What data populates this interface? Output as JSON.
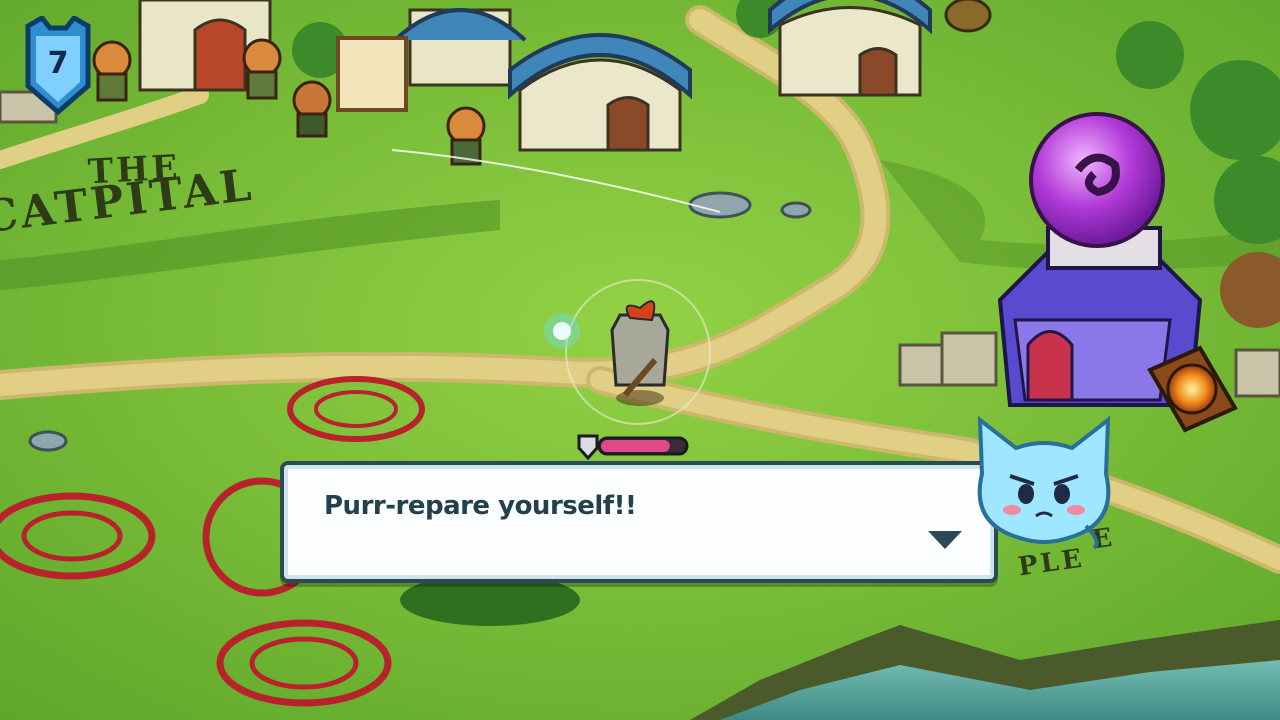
{
  "hud": {
    "level_value": "7",
    "level_icon": "shield-level-badge-icon"
  },
  "map": {
    "region_the": "THE",
    "region_catpital": "CATPITAL",
    "region_right_top": "E",
    "region_right_bottom": "PLE"
  },
  "dialog": {
    "text": "Purr-repare yourself!!",
    "advance_icon": "chevron-down-icon",
    "speaker_icon": "spirry-blue-cat-icon"
  },
  "player": {
    "health_fraction": 0.82
  },
  "colors": {
    "grass": "#7cc23a",
    "path": "#d8c778",
    "dialog_border": "#2b4a55",
    "dialog_text": "#24404a",
    "health": "#e04a8a",
    "rune": "#b8222a",
    "shield_badge": "#2d8fd2",
    "orb": "#b13ad8",
    "water": "#5fa7a0"
  }
}
